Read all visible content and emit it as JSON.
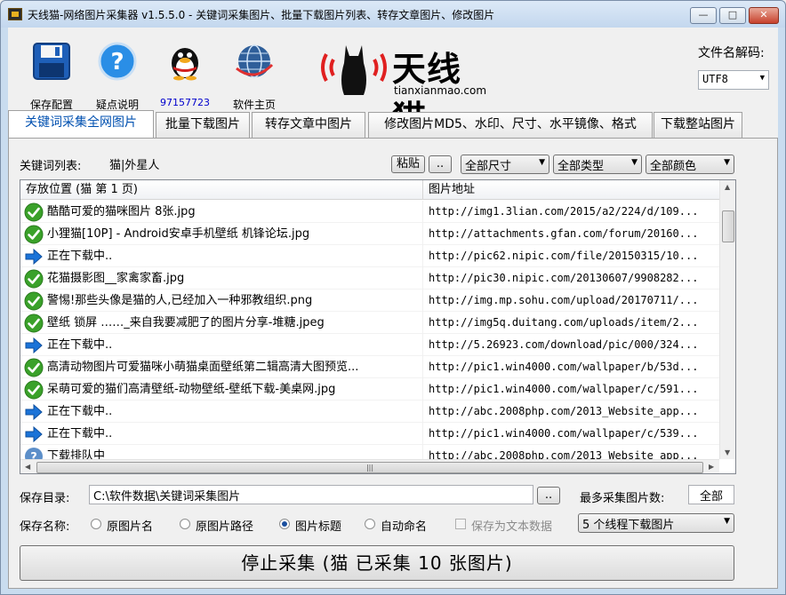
{
  "window": {
    "title": "天线猫-网络图片采集器 v1.5.5.0 - 关键词采集图片、批量下载图片列表、转存文章图片、修改图片"
  },
  "toolbar": {
    "save_label": "保存配置",
    "help_label": "疑点说明",
    "qq_label": "97157723",
    "home_label": "软件主页"
  },
  "logo": {
    "cn": "天线猫",
    "en": "tianxianmao.com"
  },
  "decode": {
    "label": "文件名解码:",
    "value": "UTF8"
  },
  "tabs": [
    {
      "label": "关键词采集全网图片"
    },
    {
      "label": "批量下载图片"
    },
    {
      "label": "转存文章中图片"
    },
    {
      "label": "修改图片MD5、水印、尺寸、水平镜像、格式"
    },
    {
      "label": "下载整站图片"
    }
  ],
  "keywords": {
    "label": "关键词列表:",
    "value": "猫|外星人",
    "paste_label": "粘贴",
    "browse_label": "..",
    "size_filter": "全部尺寸",
    "type_filter": "全部类型",
    "color_filter": "全部颜色"
  },
  "list": {
    "col_location": "存放位置 (猫 第 1 页)",
    "col_url": "图片地址",
    "rows": [
      {
        "status": "done",
        "name": "酷酷可爱的猫咪图片 8张.jpg",
        "url": "http://img1.3lian.com/2015/a2/224/d/109..."
      },
      {
        "status": "done",
        "name": "小狸猫[10P] - Android安卓手机壁纸 机锋论坛.jpg",
        "url": "http://attachments.gfan.com/forum/20160..."
      },
      {
        "status": "downloading",
        "name": "正在下载中..",
        "url": "http://pic62.nipic.com/file/20150315/10..."
      },
      {
        "status": "done",
        "name": "花猫摄影图__家禽家畜.jpg",
        "url": "http://pic30.nipic.com/20130607/9908282..."
      },
      {
        "status": "done",
        "name": "警惕!那些头像是猫的人,已经加入一种邪教组织.png",
        "url": "http://img.mp.sohu.com/upload/20170711/..."
      },
      {
        "status": "done",
        "name": "壁纸 锁屏 ……_来自我要减肥了的图片分享-堆糖.jpeg",
        "url": "http://img5q.duitang.com/uploads/item/2..."
      },
      {
        "status": "downloading",
        "name": "正在下载中..",
        "url": "http://5.26923.com/download/pic/000/324..."
      },
      {
        "status": "done",
        "name": "高清动物图片可爱猫咪小萌猫桌面壁纸第二辑高清大图预览...",
        "url": "http://pic1.win4000.com/wallpaper/b/53d..."
      },
      {
        "status": "done",
        "name": "呆萌可爱的猫们高清壁纸-动物壁纸-壁纸下载-美桌网.jpg",
        "url": "http://pic1.win4000.com/wallpaper/c/591..."
      },
      {
        "status": "downloading",
        "name": "正在下载中..",
        "url": "http://abc.2008php.com/2013_Website_app..."
      },
      {
        "status": "downloading",
        "name": "正在下载中..",
        "url": "http://pic1.win4000.com/wallpaper/c/539..."
      },
      {
        "status": "queued",
        "name": "下载排队中",
        "url": "http://abc.2008php.com/2013_Website_app..."
      }
    ]
  },
  "save": {
    "dir_label": "保存目录:",
    "dir_value": "C:\\软件数据\\关键词采集图片",
    "browse_label": "..",
    "max_label": "最多采集图片数:",
    "max_value": "全部",
    "name_label": "保存名称:",
    "options": [
      {
        "label": "原图片名",
        "checked": false
      },
      {
        "label": "原图片路径",
        "checked": false
      },
      {
        "label": "图片标题",
        "checked": true
      },
      {
        "label": "自动命名",
        "checked": false
      }
    ],
    "text_data_label": "保存为文本数据",
    "threads": "5 个线程下载图片"
  },
  "action": {
    "label": "停止采集 (猫 已采集 10 张图片)"
  },
  "colors": {
    "accent_tab": "#0050b0",
    "qq_label": "#0000cc",
    "done_icon": "#3aa12a",
    "downloading_icon": "#1a73d8",
    "logo_red": "#e02020"
  }
}
